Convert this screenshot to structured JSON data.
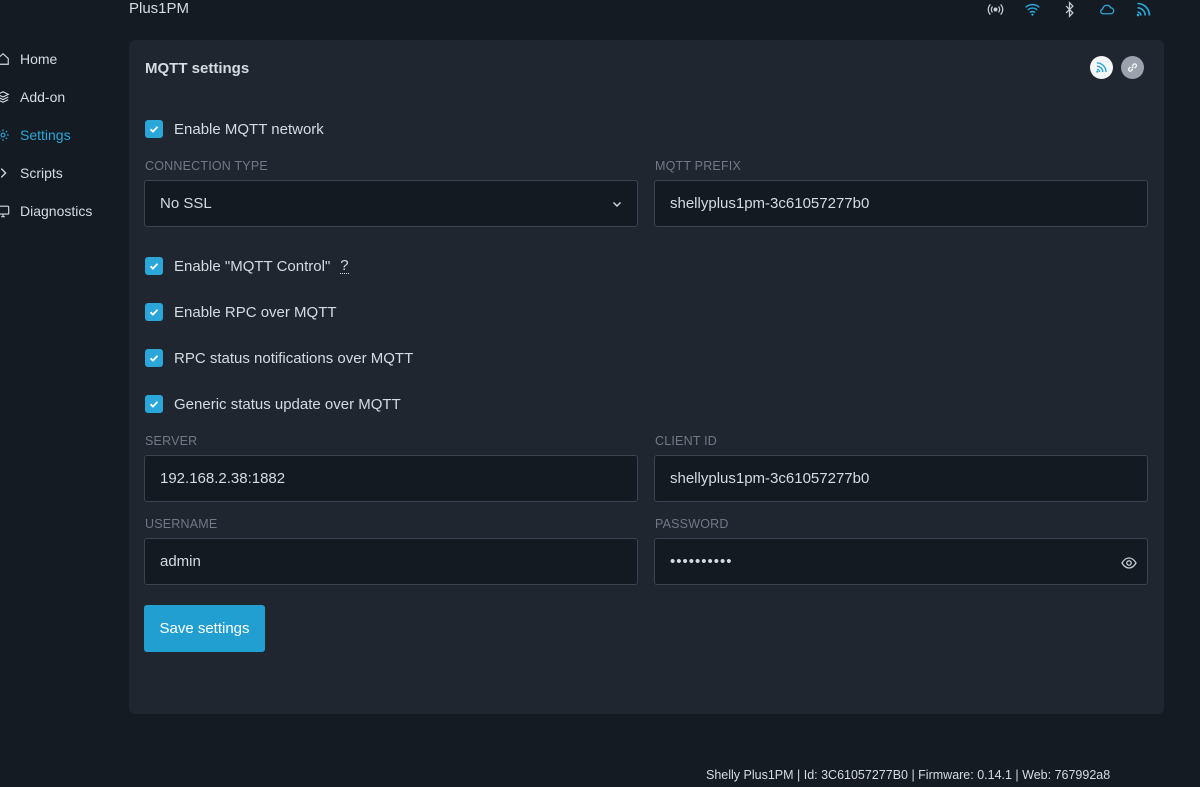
{
  "header": {
    "device_name": "Plus1PM"
  },
  "sidebar": {
    "items": [
      {
        "label": "Home"
      },
      {
        "label": "Add-on"
      },
      {
        "label": "Settings"
      },
      {
        "label": "Scripts"
      },
      {
        "label": "Diagnostics"
      }
    ],
    "active": "Settings"
  },
  "card": {
    "title": "MQTT settings",
    "enable_mqtt_label": "Enable MQTT network",
    "connection_type": {
      "label": "CONNECTION TYPE",
      "value": "No SSL"
    },
    "mqtt_prefix": {
      "label": "MQTT PREFIX",
      "value": "shellyplus1pm-3c61057277b0"
    },
    "mqtt_control_label": "Enable \"MQTT Control\"",
    "mqtt_control_help": "?",
    "rpc_over_mqtt_label": "Enable RPC over MQTT",
    "rpc_status_label": "RPC status notifications over MQTT",
    "generic_status_label": "Generic status update over MQTT",
    "server": {
      "label": "SERVER",
      "value": "192.168.2.38:1882"
    },
    "client_id": {
      "label": "CLIENT ID",
      "value": "shellyplus1pm-3c61057277b0"
    },
    "username": {
      "label": "USERNAME",
      "value": "admin"
    },
    "password": {
      "label": "PASSWORD",
      "value": "••••••••••"
    },
    "save_label": "Save settings"
  },
  "footer": {
    "text": "Shelly Plus1PM | Id: 3C61057277B0 | Firmware: 0.14.1 | Web: 767992a8"
  },
  "colors": {
    "accent": "#2ba6d8",
    "background": "#151b23",
    "card": "#1f262f"
  },
  "icons": [
    "home-icon",
    "layers-icon",
    "gear-icon",
    "chevron-right-icon",
    "monitor-icon",
    "broadcast-icon",
    "wifi-icon",
    "bluetooth-icon",
    "cloud-icon",
    "rss-icon",
    "link-icon",
    "eye-icon",
    "chevron-down-icon",
    "check-icon"
  ]
}
